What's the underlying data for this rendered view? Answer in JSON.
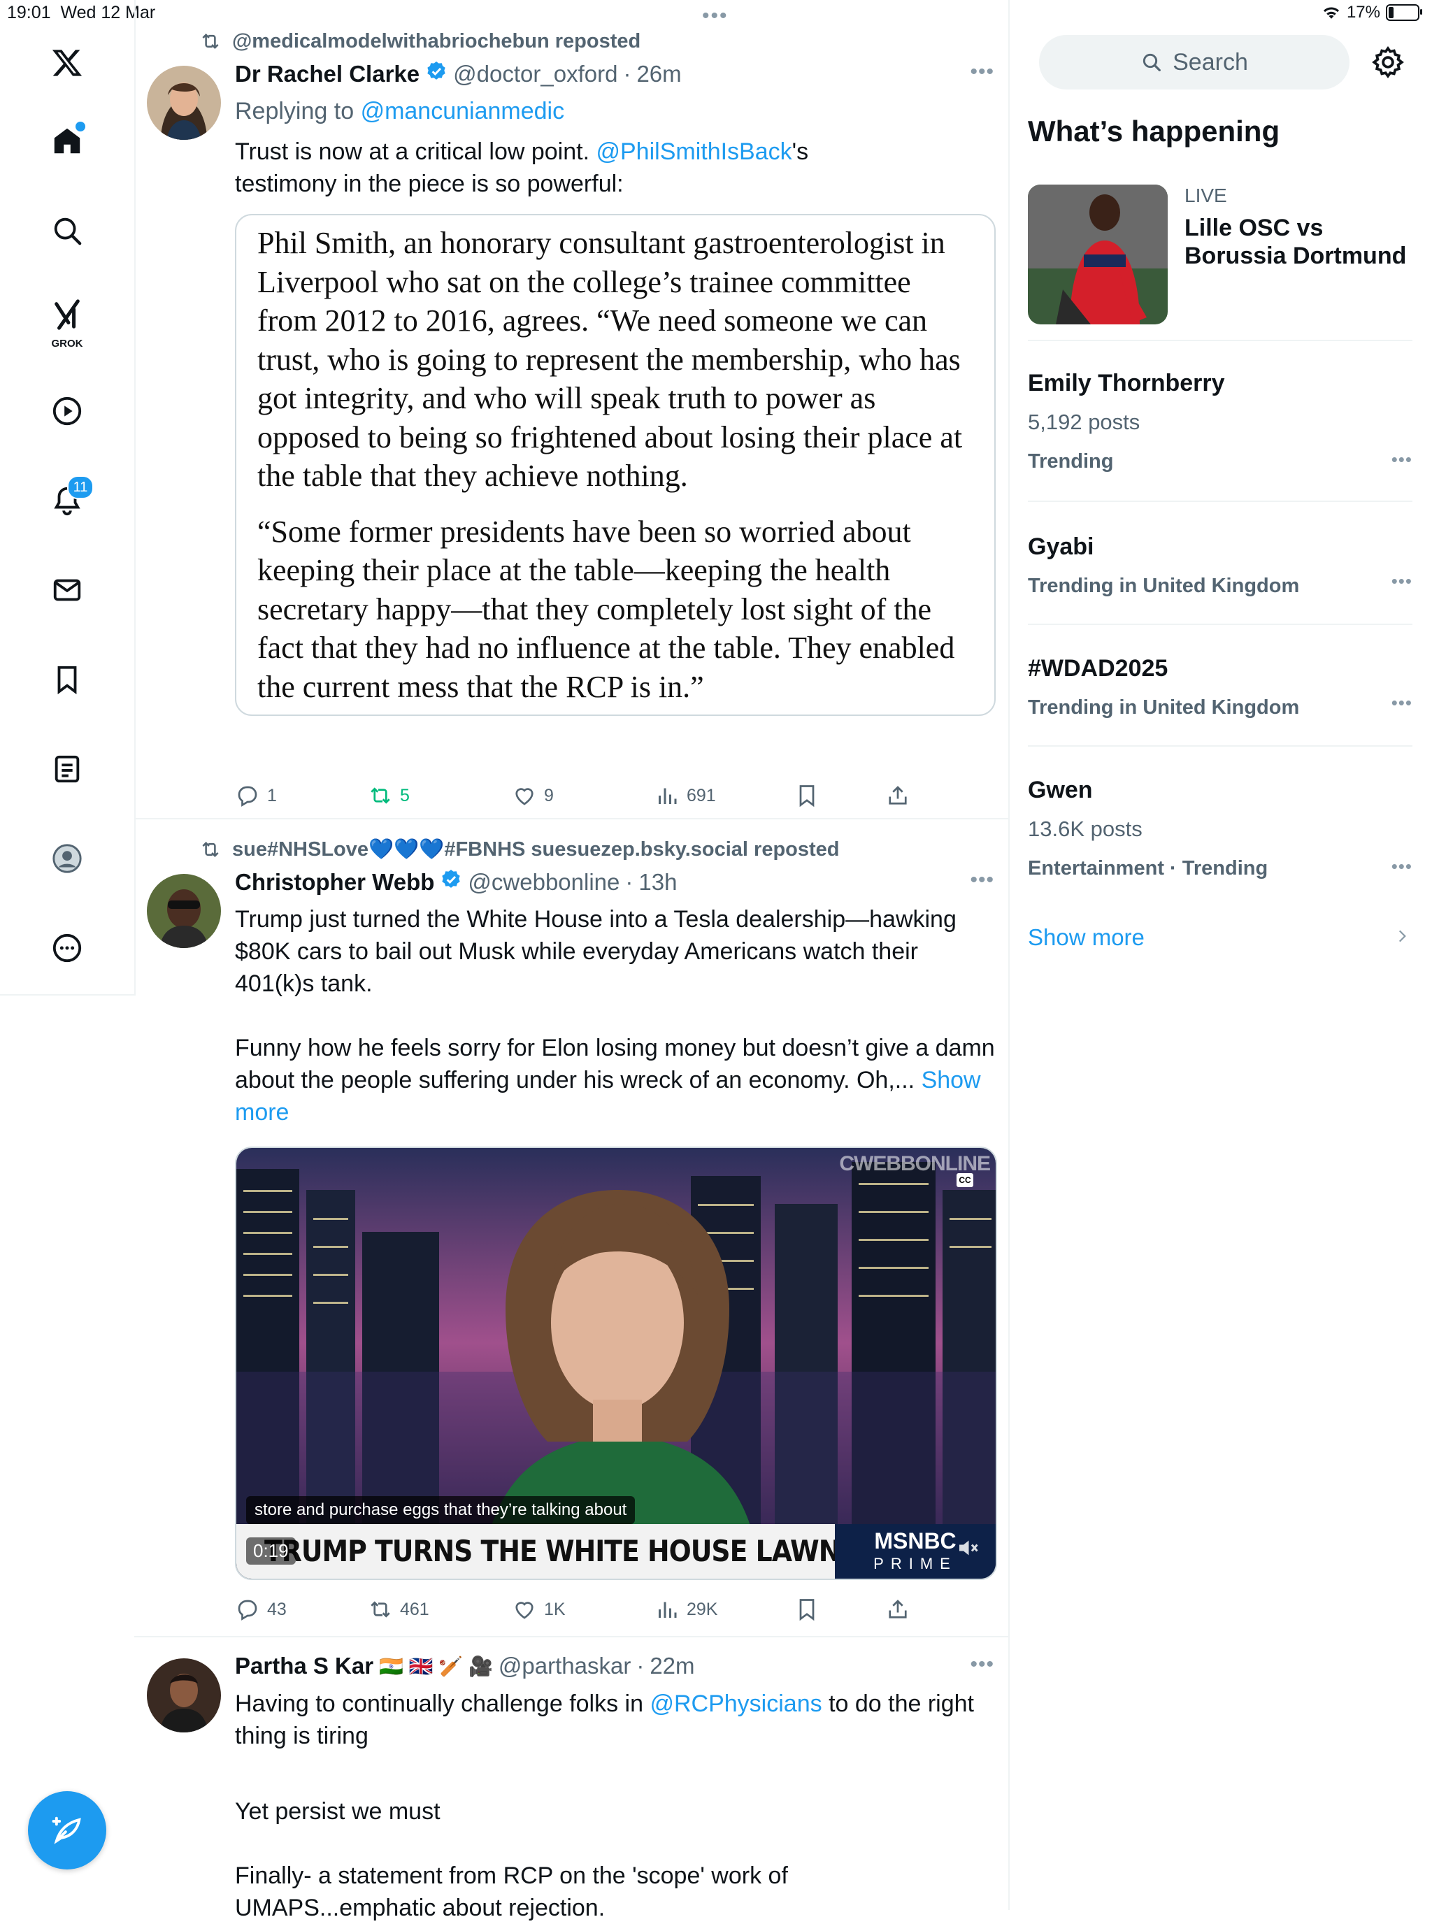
{
  "status_bar": {
    "time": "19:01",
    "date": "Wed 12 Mar",
    "battery": "17%",
    "battery_level": 0.17
  },
  "nav": {
    "grok_label": "GROK",
    "notifications_badge": "11"
  },
  "tweets": [
    {
      "repost_by": "@medicalmodelwithabriochebun reposted",
      "name": "Dr Rachel Clarke",
      "handle": "@doctor_oxford",
      "sep": "·",
      "time": "26m",
      "replying_label": "Replying to",
      "replying_to": "@mancunianmedic",
      "text_part1": "Trust is now at a critical low point.",
      "text_mention": "@PhilSmithIsBack",
      "text_part2": "'s testimony in the piece is so powerful:",
      "quote_p1": "Phil Smith, an honorary consultant gastroenterologist in Liverpool who sat on the college’s trainee committee from 2012 to 2016, agrees. “We need someone we can trust, who is going to represent the membership, who has got integrity, and who will speak truth to power as opposed to being so frightened about losing their place at the table that they achieve nothing.",
      "quote_p2": "“Some former presidents have been so worried about keeping their place at the table—keeping the health secretary happy—that they completely lost sight of the fact that they had no influence at the table. They enabled the current mess that the RCP is in.”",
      "replies": "1",
      "reposts": "5",
      "likes": "9",
      "views": "691"
    },
    {
      "repost_by": "sue#NHSLove💙💙💙#FBNHS suesuezep.bsky.social reposted",
      "name": "Christopher Webb",
      "handle": "@cwebbonline",
      "sep": "·",
      "time": "13h",
      "text_p1": "Trump just turned the White House into a Tesla dealership—hawking $80K cars to bail out Musk while everyday Americans watch their 401(k)s tank.",
      "text_p2": "Funny how he feels sorry for Elon losing money but doesn’t give a damn about the people suffering under his wreck of an economy. Oh,...",
      "show_more": "Show more",
      "video": {
        "watermark": "CWEBBONLINE",
        "cc": "CC",
        "caption": "store and purchase eggs that they’re talking about",
        "headline": "TRUMP TURNS THE WHITE HOUSE LAWN INTO A TESLA SHOWROOM",
        "network": "MSNBC",
        "network_sub": "PRIME",
        "timecode": "0:19"
      },
      "replies": "43",
      "reposts": "461",
      "likes": "1K",
      "views": "29K"
    },
    {
      "name": "Partha S Kar",
      "name_emoji": "🇮🇳 🇬🇧 🏏 🎥",
      "handle": "@parthaskar",
      "sep": "·",
      "time": "22m",
      "text_part1": "Having to continually challenge folks in",
      "text_mention": "@RCPhysicians",
      "text_part2": "to do the right thing is tiring",
      "text_p2": "Yet persist we must",
      "text_p3": "Finally- a statement from RCP on the 'scope' work of UMAPS...emphatic about rejection."
    }
  ],
  "sidebar": {
    "search_placeholder": "Search",
    "title": "What’s happening",
    "live": {
      "tag": "LIVE",
      "title": "Lille OSC vs Borussia Dortmund"
    },
    "trends": [
      {
        "title": "Emily Thornberry",
        "posts": "5,192 posts",
        "context": "Trending"
      },
      {
        "title": "Gyabi",
        "context": "Trending in United Kingdom"
      },
      {
        "title": "#WDAD2025",
        "context": "Trending in United Kingdom"
      },
      {
        "title": "Gwen",
        "posts": "13.6K posts",
        "context": "Entertainment · Trending"
      }
    ],
    "show_more": "Show more"
  },
  "colors": {
    "accent": "#1d9bf0",
    "repost_active": "#00ba7c",
    "muted": "#536471"
  }
}
